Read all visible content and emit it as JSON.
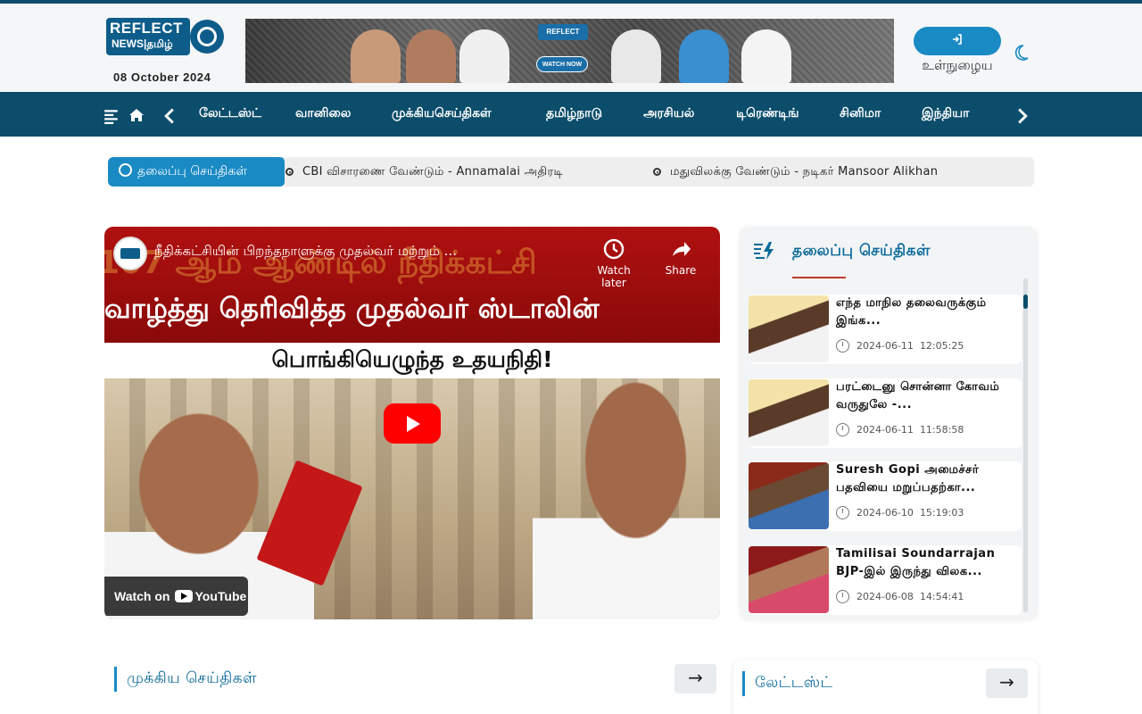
{
  "site": {
    "logo_line1": "REFLECT",
    "logo_line2": "NEWS|தமிழ்",
    "date": "08 October 2024",
    "login_label": "உள்நுழைய",
    "brand_color": "#0b4d6b",
    "accent_color": "#1a8ac4"
  },
  "banner": {
    "badge": "REFLECT",
    "watch_now": "WATCH NOW"
  },
  "nav": {
    "icons": [
      "menu-icon",
      "home-icon",
      "chevron-left-icon",
      "chevron-right-icon"
    ],
    "items": [
      "லேட்டஸ்ட்",
      "வானிலை",
      "முக்கியசெய்திகள்",
      "தமிழ்நாடு",
      "அரசியல்",
      "டிரெண்டிங்",
      "சினிமா",
      "இந்தியா"
    ]
  },
  "ticker": {
    "label": "தலைப்பு செய்திகள்",
    "items": [
      "CBI விசாரணை வேண்டும் - Annamalai அதிரடி",
      "மதுவிலக்கு வேண்டும் - நடிகர் Mansoor Alikhan"
    ]
  },
  "video": {
    "title": "நீதிக்கட்சியின் பிறந்தநாளுக்கு முதல்வர் மற்றும் ...",
    "overlay_line1": "107 ஆம் ஆண்டில் நீதிக்கட்சி",
    "overlay_line2": "வாழ்த்து தெரிவித்த முதல்வர் ஸ்டாலின்",
    "overlay_line3": "பொங்கியெழுந்த உதயநிதி!",
    "watch_later": "Watch later",
    "share": "Share",
    "watch_on": "Watch on",
    "youtube": "YouTube"
  },
  "side": {
    "title": "தலைப்பு செய்திகள்",
    "cards": [
      {
        "title": "எந்த மாநில தலைவருக்கும் இங்க...",
        "date": "2024-06-11",
        "time": "12:05:25"
      },
      {
        "title": "பரட்டைனு சொன்னா கோவம் வருதுலே -...",
        "date": "2024-06-11",
        "time": "11:58:58"
      },
      {
        "title": "Suresh Gopi அமைச்சர் பதவியை மறுப்பதற்கா...",
        "date": "2024-06-10",
        "time": "15:19:03"
      },
      {
        "title": "Tamilisai Soundarrajan BJP-இல் இருந்து விலக...",
        "date": "2024-06-08",
        "time": "14:54:41"
      }
    ]
  },
  "sections": {
    "main_news": "முக்கிய செய்திகள்",
    "latest": "லேட்டஸ்ட்",
    "arrow": "→"
  }
}
